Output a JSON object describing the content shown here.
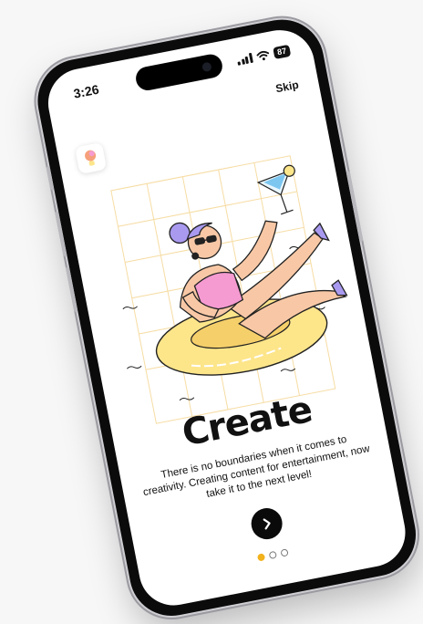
{
  "status_bar": {
    "time": "3:26",
    "battery": "87"
  },
  "header": {
    "skip_label": "Skip"
  },
  "onboarding": {
    "title": "Create",
    "description": "There is no boundaries when it comes to creativity. Creating content for entertainment, now take it to the next level!",
    "current_page": 1,
    "total_pages": 3
  },
  "icons": {
    "app": "app-logo-icon",
    "next": "chevron-right-icon",
    "signal": "signal-icon",
    "wifi": "wifi-icon",
    "battery": "battery-icon"
  },
  "colors": {
    "accent_yellow": "#f2b21c",
    "float_ring": "#fde58a",
    "swimsuit_pink": "#f59bd1",
    "hair_purple": "#a99af0",
    "button_black": "#0a0a0a"
  }
}
